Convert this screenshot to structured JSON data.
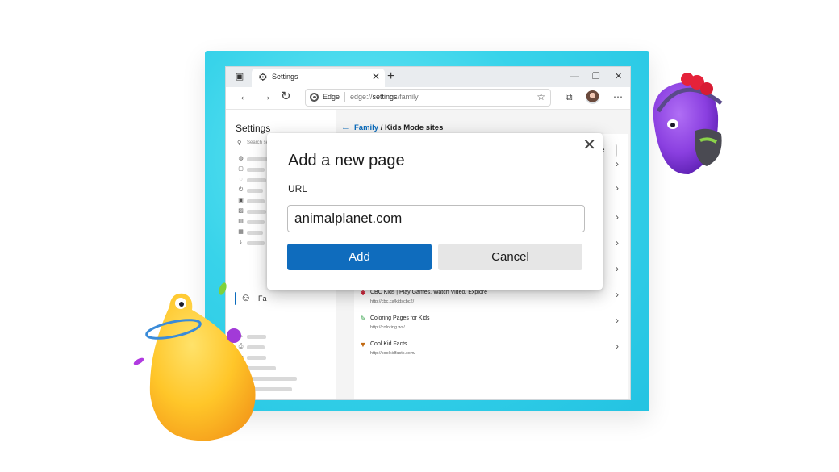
{
  "browser": {
    "tab": {
      "title": "Settings"
    },
    "address": {
      "brand": "Edge",
      "url_prefix": "edge://",
      "url_main": "settings",
      "url_suffix": "/family"
    }
  },
  "sidebar": {
    "title": "Settings",
    "search_placeholder": "Search se",
    "active_item_label": "Fa"
  },
  "main": {
    "breadcrumb_parent": "Family",
    "breadcrumb_sep": " / ",
    "breadcrumb_current": "Kids Mode sites",
    "add_site_button": "site",
    "sites": [
      {
        "title": "CBC Kids | Play Games, Watch Video, Explore",
        "url": "http://cbc.ca/kidscbc2/",
        "icon": "cbc-icon"
      },
      {
        "title": "Coloring Pages for Kids",
        "url": "http://coloring.ws/",
        "icon": "coloring-icon"
      },
      {
        "title": "Cool Kid Facts",
        "url": "http://coolkidfacts.com/",
        "icon": "fox-icon"
      }
    ]
  },
  "dialog": {
    "title": "Add a new page",
    "label": "URL",
    "input_value": "animalplanet.com",
    "add_label": "Add",
    "cancel_label": "Cancel"
  },
  "colors": {
    "frame": "#38d3ea",
    "accent": "#0f6cbd",
    "cancel_bg": "#e6e6e6"
  }
}
